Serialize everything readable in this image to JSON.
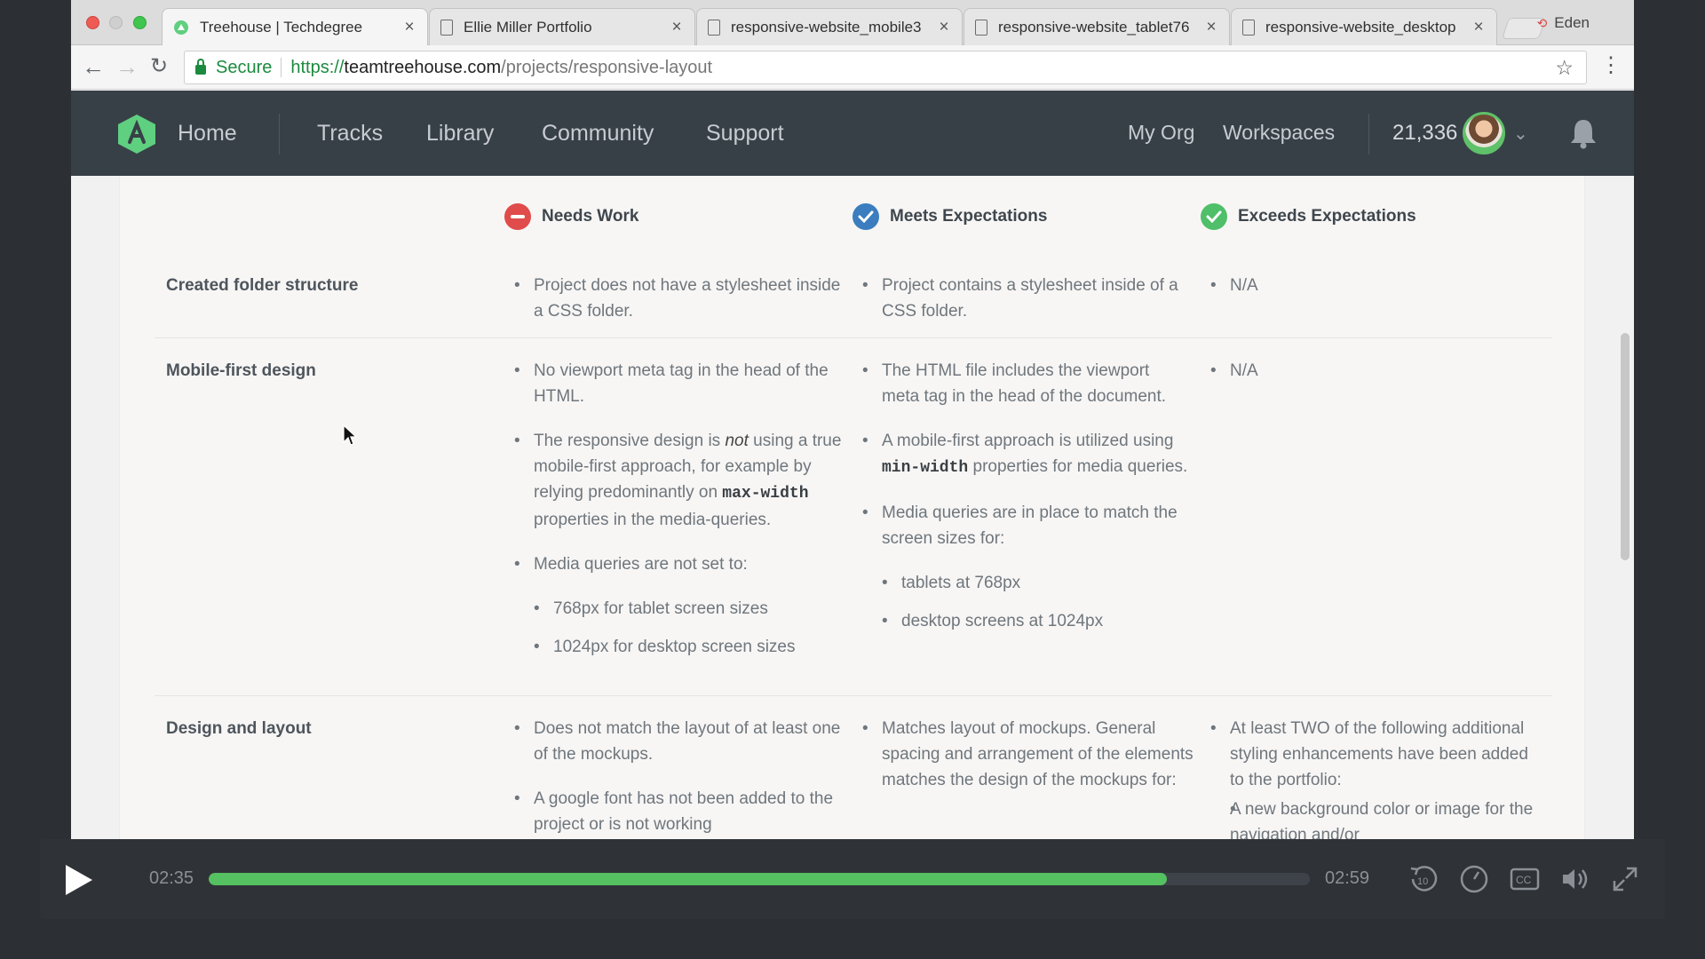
{
  "browser": {
    "tabs": [
      {
        "title": "Treehouse | Techdegree",
        "active": true
      },
      {
        "title": "Ellie Miller Portfolio",
        "active": false
      },
      {
        "title": "responsive-website_mobile3",
        "active": false
      },
      {
        "title": "responsive-website_tablet76",
        "active": false
      },
      {
        "title": "responsive-website_desktop",
        "active": false
      }
    ],
    "profile_name": "Eden",
    "secure_label": "Secure",
    "url": {
      "scheme": "https://",
      "host": "teamtreehouse.com",
      "path": "/projects/responsive-layout"
    }
  },
  "site_nav": {
    "home": "Home",
    "links": [
      "Tracks",
      "Library",
      "Community",
      "Support"
    ],
    "right_links": [
      "My Org",
      "Workspaces"
    ],
    "points": "21,336"
  },
  "rubric": {
    "columns": [
      "Needs Work",
      "Meets Expectations",
      "Exceeds Expectations"
    ],
    "rows": [
      {
        "label": "Created folder structure",
        "needs_work": [
          "Project does not have a stylesheet inside a CSS folder."
        ],
        "meets": [
          "Project contains a stylesheet inside of a CSS folder."
        ],
        "exceeds": [
          "N/A"
        ]
      },
      {
        "label": "Mobile-first design",
        "needs_work": {
          "item1": "No viewport meta tag in the head of the HTML.",
          "item2_before_em": "The responsive design is ",
          "item2_em": "not",
          "item2_after_em": " using a true mobile-first approach, for example by relying predominantly on ",
          "item2_code": "max-width",
          "item2_end": " properties in the media-queries.",
          "item3": "Media queries are not set to:",
          "sub": [
            "768px for tablet screen sizes",
            "1024px for desktop screen sizes"
          ]
        },
        "meets": {
          "item1": "The HTML file includes the viewport meta tag in the head of the document.",
          "item2_before_code": "A mobile-first approach is utilized using ",
          "item2_code": "min-width",
          "item2_after_code": " properties for media queries.",
          "item3": "Media queries are in place to match the screen sizes for:",
          "sub": [
            "tablets at 768px",
            "desktop screens at 1024px"
          ]
        },
        "exceeds": [
          "N/A"
        ]
      },
      {
        "label": "Design and layout",
        "needs_work": [
          "Does not match the layout of at least one of the mockups.",
          "A google font has not been added to the project or is not working"
        ],
        "meets": [
          "Matches layout of mockups. General spacing and arrangement of the elements matches the design of the mockups for:"
        ],
        "exceeds": {
          "item1": "At least TWO of the following additional styling enhancements have been added to the portfolio:",
          "sub": [
            "A new background color or image for the navigation and/or"
          ]
        }
      }
    ]
  },
  "player": {
    "current_time": "02:35",
    "duration": "02:59",
    "progress_fraction": 0.87,
    "controls": [
      "rewind-10-icon",
      "speed-icon",
      "captions-icon",
      "volume-icon",
      "fullscreen-icon"
    ]
  },
  "colors": {
    "accent_green": "#55c160",
    "header_bg": "#384047",
    "needs_work_red": "#e04b4b",
    "meets_blue": "#3b7dbf",
    "exceeds_green": "#4fbf69"
  }
}
